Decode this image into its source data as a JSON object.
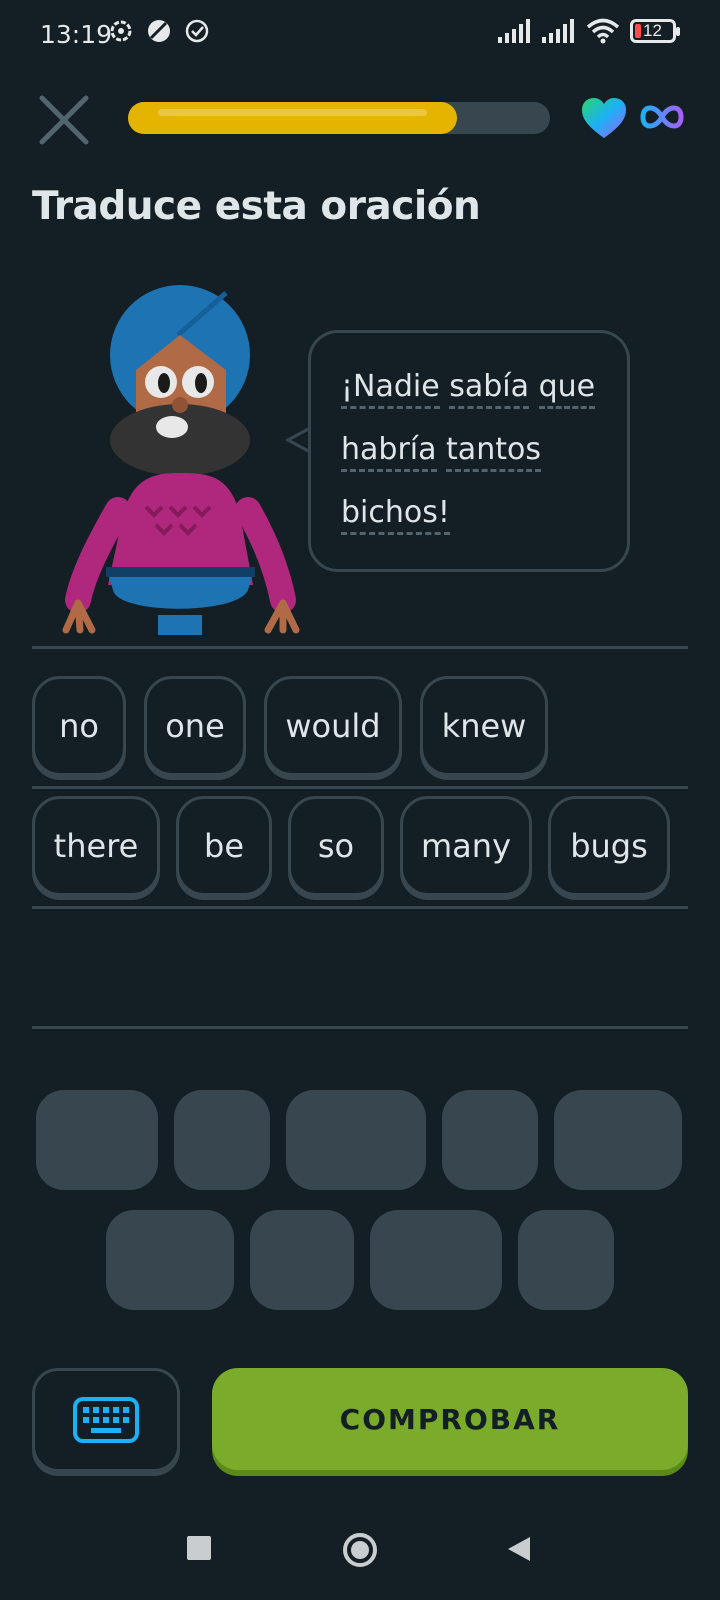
{
  "status_bar": {
    "time": "13:19",
    "battery": "12",
    "icons_left": [
      "settings-sync-icon",
      "moon-icon",
      "check-circle-icon"
    ],
    "icons_right": [
      "signal-icon",
      "signal-icon",
      "wifi-icon",
      "battery-icon"
    ]
  },
  "header": {
    "progress": 0.78,
    "hearts": "∞"
  },
  "exercise": {
    "title": "Traduce esta oración",
    "sentence_lines": [
      [
        "¡Nadie",
        "sabía",
        "que"
      ],
      [
        "habría",
        "tantos"
      ],
      [
        "bichos!"
      ]
    ]
  },
  "word_bank_rows": [
    [
      "no",
      "one",
      "would",
      "knew"
    ],
    [
      "there",
      "be",
      "so",
      "many",
      "bugs"
    ]
  ],
  "actions": {
    "check_label": "COMPROBAR"
  },
  "colors": {
    "background": "#131f24",
    "border": "#37464f",
    "progress": "#e5b400",
    "check_button": "#7aab2a",
    "keyboard_icon": "#1cb0f6"
  }
}
